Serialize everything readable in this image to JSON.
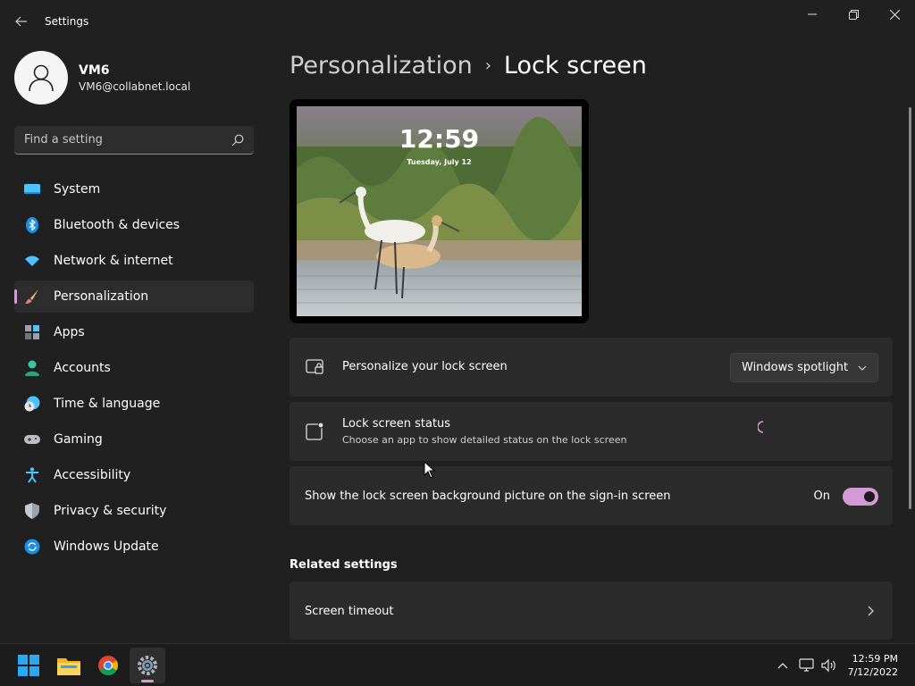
{
  "window": {
    "title": "Settings"
  },
  "profile": {
    "name": "VM6",
    "email": "VM6@collabnet.local"
  },
  "search": {
    "placeholder": "Find a setting"
  },
  "sidebar": {
    "items": [
      {
        "label": "System",
        "icon": "system-icon"
      },
      {
        "label": "Bluetooth & devices",
        "icon": "bluetooth-icon"
      },
      {
        "label": "Network & internet",
        "icon": "wifi-icon"
      },
      {
        "label": "Personalization",
        "icon": "brush-icon",
        "active": true
      },
      {
        "label": "Apps",
        "icon": "apps-icon"
      },
      {
        "label": "Accounts",
        "icon": "accounts-icon"
      },
      {
        "label": "Time & language",
        "icon": "clock-globe-icon"
      },
      {
        "label": "Gaming",
        "icon": "gamepad-icon"
      },
      {
        "label": "Accessibility",
        "icon": "accessibility-icon"
      },
      {
        "label": "Privacy & security",
        "icon": "shield-icon"
      },
      {
        "label": "Windows Update",
        "icon": "update-icon"
      }
    ]
  },
  "breadcrumb": {
    "parent": "Personalization",
    "separator": "›",
    "current": "Lock screen"
  },
  "preview": {
    "time": "12:59",
    "date": "Tuesday, July 12"
  },
  "settings": {
    "personalize": {
      "title": "Personalize your lock screen",
      "value": "Windows spotlight"
    },
    "status": {
      "title": "Lock screen status",
      "subtitle": "Choose an app to show detailed status on the lock screen"
    },
    "signin_background": {
      "title": "Show the lock screen background picture on the sign-in screen",
      "state_label": "On",
      "enabled": true
    }
  },
  "related": {
    "heading": "Related settings",
    "items": [
      {
        "label": "Screen timeout"
      }
    ]
  },
  "taskbar": {
    "apps": [
      "start-icon",
      "file-explorer-icon",
      "chrome-icon",
      "settings-icon"
    ],
    "time": "12:59 PM",
    "date": "7/12/2022"
  },
  "colors": {
    "accent": "#d59bd6",
    "background": "#202020",
    "card": "#2b2b2b"
  }
}
